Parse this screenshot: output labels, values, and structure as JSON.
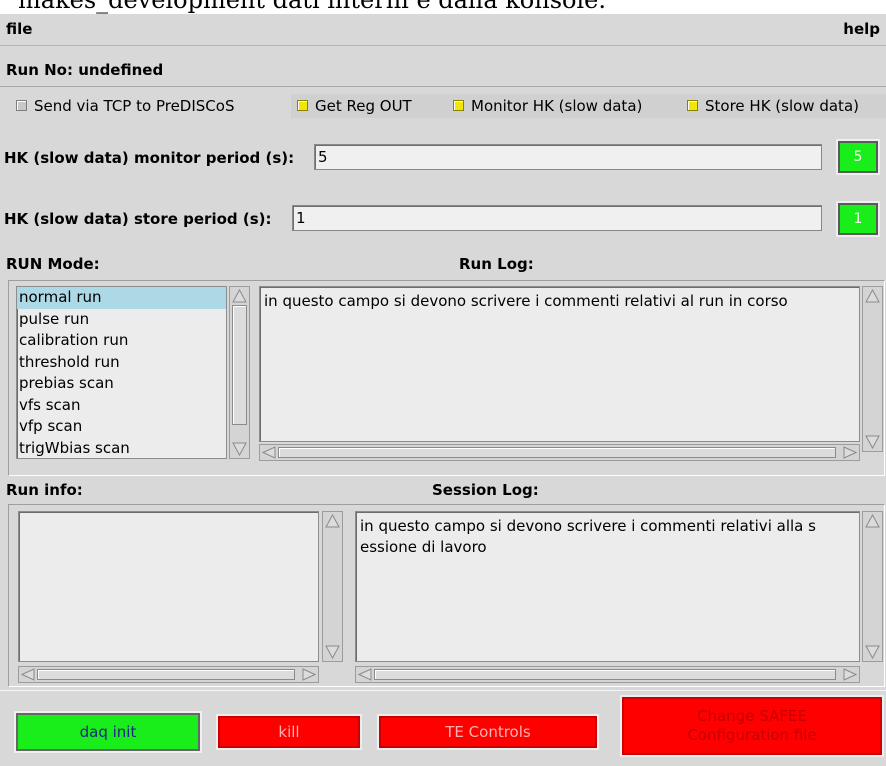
{
  "document_text": "makes_development dati interni e dalla konsole.",
  "menu": {
    "file": "file",
    "help": "help"
  },
  "run_no": "Run No: undefined",
  "checkboxes": [
    {
      "label": "Send via TCP to PreDISCoS",
      "checked": false
    },
    {
      "label": "Get Reg OUT",
      "checked": true
    },
    {
      "label": "Monitor HK (slow data)",
      "checked": true
    },
    {
      "label": "Store HK (slow data)",
      "checked": true
    }
  ],
  "hk_monitor": {
    "label": "HK (slow data) monitor period (s):",
    "value": "5",
    "button": "5"
  },
  "hk_store": {
    "label": "HK (slow data) store period (s):",
    "value": "1",
    "button": "1"
  },
  "run_mode": {
    "label": "RUN Mode:",
    "items": [
      "normal run",
      "pulse run",
      "calibration run",
      "threshold run",
      "prebias scan",
      "vfs scan",
      "vfp scan",
      "trigWbias scan"
    ],
    "selected": "normal run"
  },
  "run_log": {
    "label": "Run Log:",
    "text": "in questo campo si devono scrivere i commenti relativi al run in corso"
  },
  "run_info": {
    "label": "Run info:",
    "text": ""
  },
  "session_log": {
    "label": "Session Log:",
    "text": "in questo campo si devono scrivere i commenti relativi alla s\nessione di lavoro"
  },
  "buttons": {
    "daq_init": "daq init",
    "kill": "kill",
    "te_controls": "TE Controls",
    "change_config": "Change SAFEE\nConfiguration file"
  },
  "colors": {
    "green": "#1aee1a",
    "red": "#ff0000",
    "checkbox_on": "#f0e60a",
    "selection": "#add8e6"
  }
}
